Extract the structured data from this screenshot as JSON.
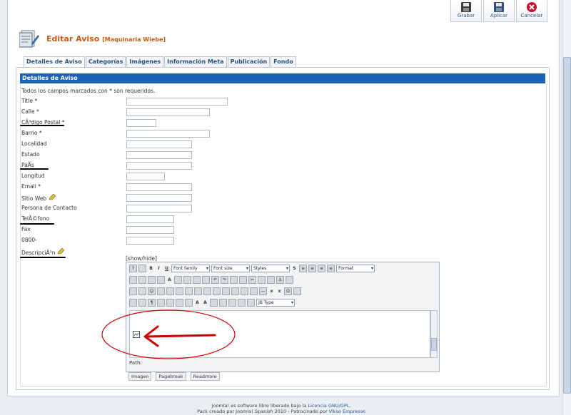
{
  "toolbar": {
    "save_label": "Grabar",
    "apply_label": "Aplicar",
    "cancel_label": "Cancelar"
  },
  "header": {
    "title": "Editar Aviso",
    "subtitle": "[Maquinaria Wiebe]"
  },
  "tabs": [
    {
      "label": "Detalles de Aviso"
    },
    {
      "label": "Categorías"
    },
    {
      "label": "Imágenes"
    },
    {
      "label": "Información Meta"
    },
    {
      "label": "Publicación"
    },
    {
      "label": "Fondo"
    }
  ],
  "panel": {
    "heading": "Detalles de Aviso",
    "note": "Todos los campos marcados con * son requeridos."
  },
  "fields": [
    {
      "label": "Title *"
    },
    {
      "label": "Calle *"
    },
    {
      "label": "CÃ³digo Postal *"
    },
    {
      "label": "Barrio *"
    },
    {
      "label": "Localidad"
    },
    {
      "label": "Estado"
    },
    {
      "label": "PaÃ­s"
    },
    {
      "label": "Longitud"
    },
    {
      "label": "Email *"
    },
    {
      "label": "Sitio Web"
    },
    {
      "label": "Persona de Contacto"
    },
    {
      "label": "TelÃ©fono"
    },
    {
      "label": "Fax"
    },
    {
      "label": "0800-"
    },
    {
      "label": "DescripciÃ³n"
    }
  ],
  "editor": {
    "showhide": "[show/hide]",
    "font_family": "Font family",
    "font_size": "Font size",
    "styles": "Styles",
    "format": "Format",
    "jb_type": "JB Type",
    "path_label": "Path:",
    "buttons": {
      "image": "Imagen",
      "pagebreak": "Pagebreak",
      "readmore": "Readmore"
    }
  },
  "footer": {
    "line1_text": "Joomla! es software libre liberado bajo la",
    "line1_link": "Licencia GNU/GPL.",
    "line2_text": "Pack creado por Joomla! Spanish 2010 - Patrocinado por",
    "line2_link": "Vikso Empresas"
  },
  "colors": {
    "header_blue": "#1b62b5",
    "title_orange": "#c55a11",
    "annotation_red": "#cc0000"
  }
}
